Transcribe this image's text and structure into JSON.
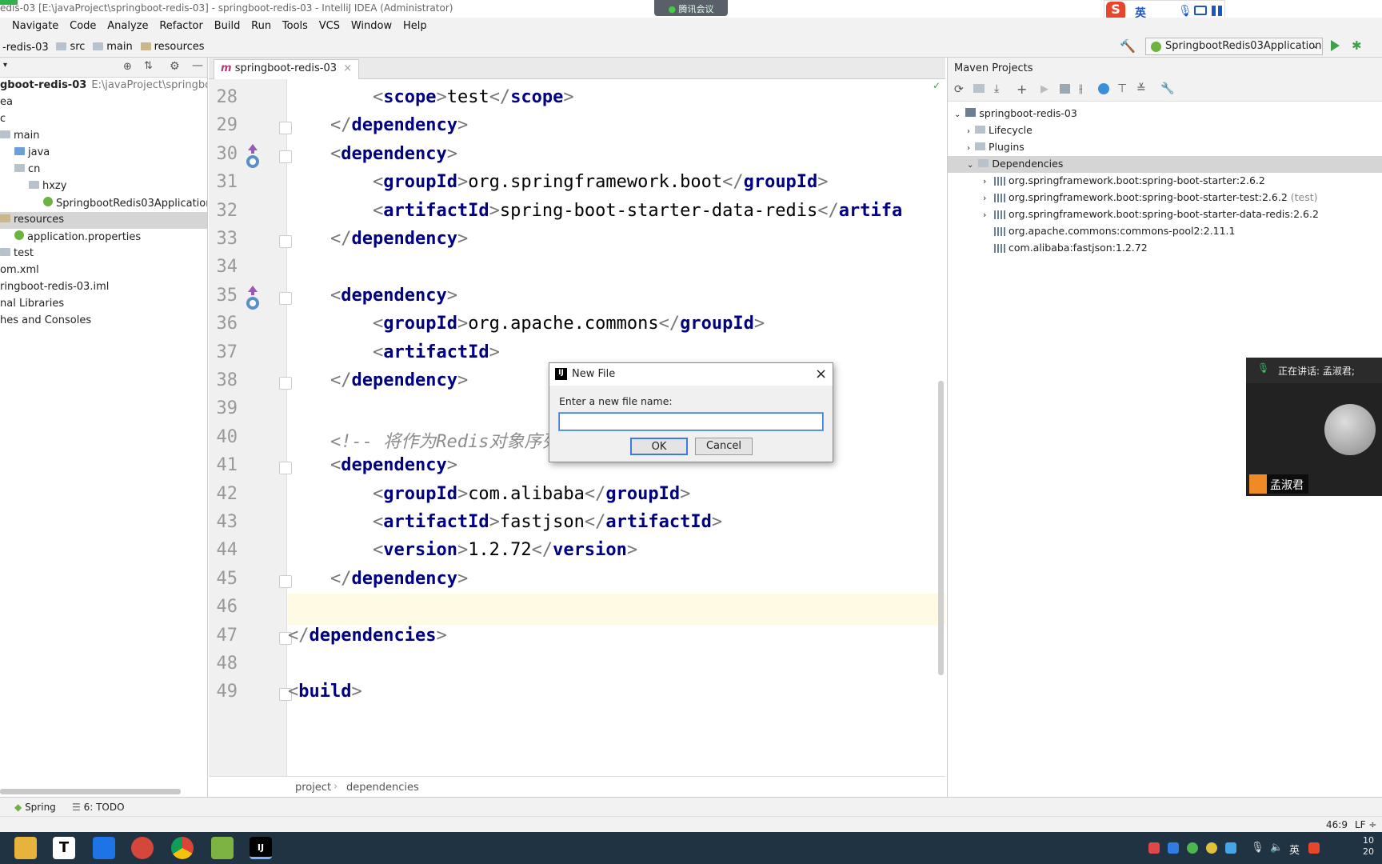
{
  "window": {
    "title": "edis-03 [E:\\javaProject\\springboot-redis-03] - springboot-redis-03 - IntelliJ IDEA (Administrator)",
    "meeting_badge": "腾讯会议",
    "ime_lang": "英"
  },
  "menu": [
    "Navigate",
    "Code",
    "Analyze",
    "Refactor",
    "Build",
    "Run",
    "Tools",
    "VCS",
    "Window",
    "Help"
  ],
  "breadcrumbs": [
    "-redis-03",
    "src",
    "main",
    "resources"
  ],
  "run_config": "SpringbootRedis03Application",
  "project_tree": [
    {
      "label": "gboot-redis-03",
      "hint": "E:\\javaProject\\springboot-re",
      "indent": 0,
      "bold": true
    },
    {
      "label": "ea",
      "indent": 0
    },
    {
      "label": "c",
      "indent": 0
    },
    {
      "label": "main",
      "indent": 0
    },
    {
      "label": "java",
      "indent": 1
    },
    {
      "label": "cn",
      "indent": 1
    },
    {
      "label": "hxzy",
      "indent": 2
    },
    {
      "label": "SpringbootRedis03Applicatior",
      "indent": 3
    },
    {
      "label": "resources",
      "indent": 0,
      "selected": true
    },
    {
      "label": "application.properties",
      "indent": 1
    },
    {
      "label": "test",
      "indent": 0
    },
    {
      "label": "om.xml",
      "indent": 0
    },
    {
      "label": "ringboot-redis-03.iml",
      "indent": 0
    },
    {
      "label": "nal Libraries",
      "indent": 0
    },
    {
      "label": "hes and Consoles",
      "indent": 0
    }
  ],
  "editor": {
    "tab": "springboot-redis-03",
    "lines": [
      {
        "n": "28",
        "parts": [
          [
            "br",
            "        <"
          ],
          [
            "tg",
            "scope"
          ],
          [
            "br",
            ">"
          ],
          [
            "tx",
            "test"
          ],
          [
            "br",
            "</"
          ],
          [
            "tg",
            "scope"
          ],
          [
            "br",
            ">"
          ]
        ]
      },
      {
        "n": "29",
        "parts": [
          [
            "br",
            "    </"
          ],
          [
            "tg",
            "dependency"
          ],
          [
            "br",
            ">"
          ]
        ]
      },
      {
        "n": "30",
        "parts": [
          [
            "br",
            "    <"
          ],
          [
            "tg",
            "dependency"
          ],
          [
            "br",
            ">"
          ]
        ]
      },
      {
        "n": "31",
        "parts": [
          [
            "br",
            "        <"
          ],
          [
            "tg",
            "groupId"
          ],
          [
            "br",
            ">"
          ],
          [
            "tx",
            "org.springframework.boot"
          ],
          [
            "br",
            "</"
          ],
          [
            "tg",
            "groupId"
          ],
          [
            "br",
            ">"
          ]
        ]
      },
      {
        "n": "32",
        "parts": [
          [
            "br",
            "        <"
          ],
          [
            "tg",
            "artifactId"
          ],
          [
            "br",
            ">"
          ],
          [
            "tx",
            "spring-boot-starter-data-redis"
          ],
          [
            "br",
            "</"
          ],
          [
            "tg",
            "artifa"
          ]
        ]
      },
      {
        "n": "33",
        "parts": [
          [
            "br",
            "    </"
          ],
          [
            "tg",
            "dependency"
          ],
          [
            "br",
            ">"
          ]
        ]
      },
      {
        "n": "34",
        "parts": []
      },
      {
        "n": "35",
        "parts": [
          [
            "br",
            "    <"
          ],
          [
            "tg",
            "dependency"
          ],
          [
            "br",
            ">"
          ]
        ]
      },
      {
        "n": "36",
        "parts": [
          [
            "br",
            "        <"
          ],
          [
            "tg",
            "groupId"
          ],
          [
            "br",
            ">"
          ],
          [
            "tx",
            "org.apache.commons"
          ],
          [
            "br",
            "</"
          ],
          [
            "tg",
            "groupId"
          ],
          [
            "br",
            ">"
          ]
        ]
      },
      {
        "n": "37",
        "parts": [
          [
            "br",
            "        <"
          ],
          [
            "tg",
            "artifactId"
          ],
          [
            "br",
            ">"
          ]
        ]
      },
      {
        "n": "38",
        "parts": [
          [
            "br",
            "    </"
          ],
          [
            "tg",
            "dependency"
          ],
          [
            "br",
            ">"
          ]
        ]
      },
      {
        "n": "39",
        "parts": []
      },
      {
        "n": "40",
        "parts": [
          [
            "cm",
            "    <!-- 将作为Redis对象序列化器 -->"
          ]
        ]
      },
      {
        "n": "41",
        "parts": [
          [
            "br",
            "    <"
          ],
          [
            "tg",
            "dependency"
          ],
          [
            "br",
            ">"
          ]
        ]
      },
      {
        "n": "42",
        "parts": [
          [
            "br",
            "        <"
          ],
          [
            "tg",
            "groupId"
          ],
          [
            "br",
            ">"
          ],
          [
            "tx",
            "com.alibaba"
          ],
          [
            "br",
            "</"
          ],
          [
            "tg",
            "groupId"
          ],
          [
            "br",
            ">"
          ]
        ]
      },
      {
        "n": "43",
        "parts": [
          [
            "br",
            "        <"
          ],
          [
            "tg",
            "artifactId"
          ],
          [
            "br",
            ">"
          ],
          [
            "tx",
            "fastjson"
          ],
          [
            "br",
            "</"
          ],
          [
            "tg",
            "artifactId"
          ],
          [
            "br",
            ">"
          ]
        ]
      },
      {
        "n": "44",
        "parts": [
          [
            "br",
            "        <"
          ],
          [
            "tg",
            "version"
          ],
          [
            "br",
            ">"
          ],
          [
            "tx",
            "1.2.72"
          ],
          [
            "br",
            "</"
          ],
          [
            "tg",
            "version"
          ],
          [
            "br",
            ">"
          ]
        ]
      },
      {
        "n": "45",
        "parts": [
          [
            "br",
            "    </"
          ],
          [
            "tg",
            "dependency"
          ],
          [
            "br",
            ">"
          ]
        ]
      },
      {
        "n": "46",
        "parts": [],
        "current": true
      },
      {
        "n": "47",
        "parts": [
          [
            "br",
            "</"
          ],
          [
            "tg",
            "dependencies"
          ],
          [
            "br",
            ">"
          ]
        ]
      },
      {
        "n": "48",
        "parts": []
      },
      {
        "n": "49",
        "parts": [
          [
            "br",
            "<"
          ],
          [
            "tg",
            "build"
          ],
          [
            "br",
            ">"
          ]
        ]
      }
    ],
    "status_path": [
      "project",
      "dependencies"
    ]
  },
  "maven": {
    "title": "Maven Projects",
    "root": "springboot-redis-03",
    "nodes": [
      "Lifecycle",
      "Plugins",
      "Dependencies"
    ],
    "deps": [
      {
        "name": "org.springframework.boot:spring-boot-starter:2.6.2",
        "scope": ""
      },
      {
        "name": "org.springframework.boot:spring-boot-starter-test:2.6.2",
        "scope": "(test)"
      },
      {
        "name": "org.springframework.boot:spring-boot-starter-data-redis:2.6.2",
        "scope": ""
      },
      {
        "name": "org.apache.commons:commons-pool2:2.11.1",
        "scope": ""
      },
      {
        "name": "com.alibaba:fastjson:1.2.72",
        "scope": ""
      }
    ]
  },
  "dialog": {
    "title": "New File",
    "prompt": "Enter a new file name:",
    "value": "",
    "ok": "OK",
    "cancel": "Cancel"
  },
  "meeting": {
    "speaking": "正在讲话: 孟淑君;",
    "user": "孟淑君"
  },
  "toolwindows": [
    "Spring",
    "6: TODO"
  ],
  "status": {
    "position": "46:9",
    "line_sep": "LF ÷"
  },
  "taskbar": {
    "tray_lang": "英",
    "clock": "10\n20"
  }
}
